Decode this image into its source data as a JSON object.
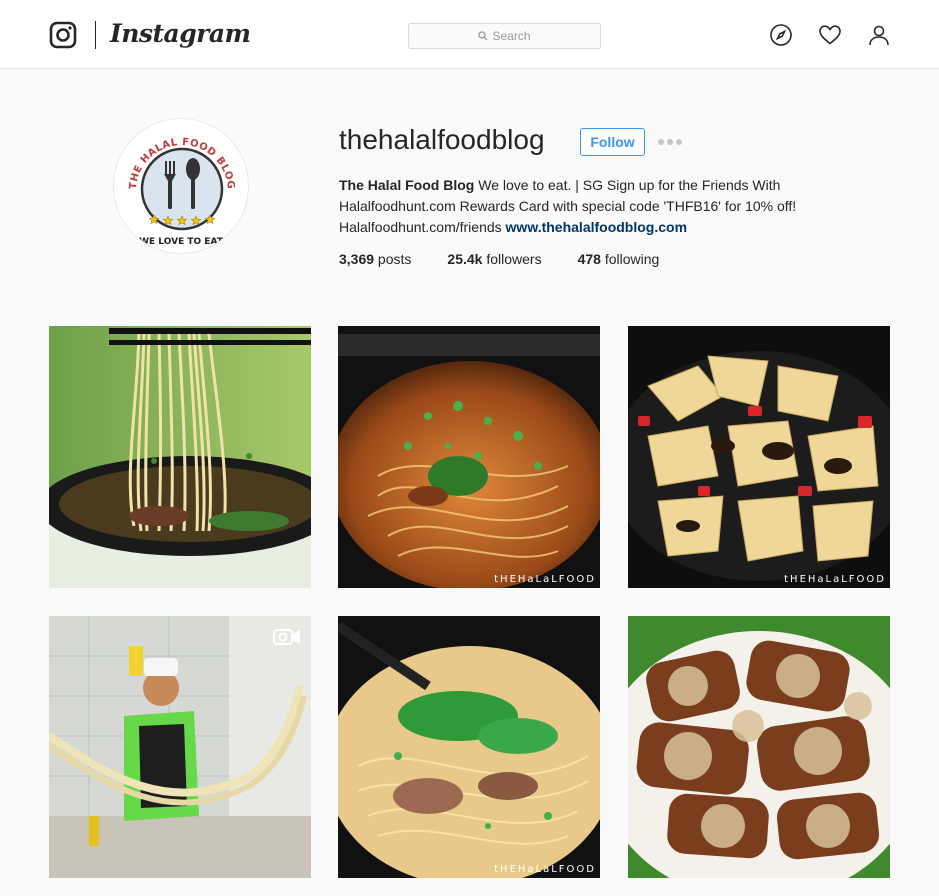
{
  "nav": {
    "wordmark": "Instagram",
    "search_placeholder": "Search",
    "icons": [
      "instagram-camera-icon",
      "compass-icon",
      "heart-icon",
      "person-icon"
    ]
  },
  "profile": {
    "username": "thehalalfoodblog",
    "follow_label": "Follow",
    "full_name": "The Halal Food Blog",
    "bio_text": " We love to eat. | SG Sign up for the Friends With Halalfoodhunt.com Rewards Card with special code 'THFB16' for 10% off! Halalfoodhunt.com/friends ",
    "website": "www.thehalalfoodblog.com",
    "avatar_text_top": "THE HALAL FOOD BLOG",
    "avatar_text_bottom": "WE LOVE TO EAT.",
    "stats": {
      "posts_count": "3,369",
      "posts_label": " posts",
      "followers_count": "25.4k",
      "followers_label": " followers",
      "following_count": "478",
      "following_label": " following"
    }
  },
  "posts": [
    {
      "watermark": ""
    },
    {
      "watermark": "tHEHaLaLFOOD"
    },
    {
      "watermark": "tHEHaLaLFOOD"
    },
    {
      "watermark": "",
      "is_video": true
    },
    {
      "watermark": "tHEHaLaLFOOD"
    },
    {
      "watermark": ""
    }
  ],
  "colors": {
    "accent": "#3897f0",
    "link": "#003569",
    "background": "#fafafa"
  }
}
